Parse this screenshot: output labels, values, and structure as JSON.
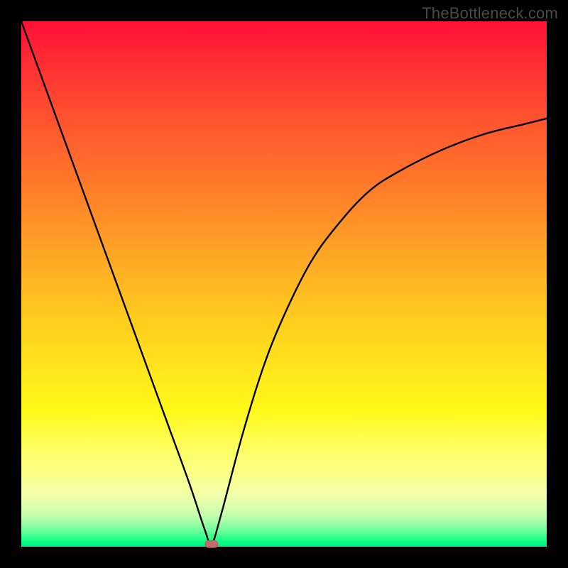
{
  "watermark": "TheBottleneck.com",
  "chart_data": {
    "type": "line",
    "title": "",
    "xlabel": "",
    "ylabel": "",
    "xlim": [
      0,
      100
    ],
    "ylim": [
      0,
      100
    ],
    "grid": false,
    "series": [
      {
        "name": "bottleneck-curve",
        "x": [
          0,
          4,
          8,
          12,
          16,
          20,
          24,
          28,
          32,
          35,
          36.2,
          38,
          42,
          46,
          50,
          55,
          60,
          66,
          72,
          80,
          88,
          96,
          100
        ],
        "values": [
          100,
          89,
          78,
          67,
          56,
          45,
          34,
          23,
          12,
          3,
          0.5,
          6,
          21,
          34,
          44,
          54,
          61,
          67.5,
          71.5,
          75.5,
          78.5,
          80.5,
          81.5
        ]
      }
    ],
    "annotations": [
      {
        "name": "minimum-marker",
        "x": 36.2,
        "y": 0.5,
        "shape": "pill",
        "color": "#c76a6a"
      }
    ],
    "background": {
      "type": "vertical-gradient",
      "stops": [
        {
          "pos": 0.0,
          "color": "#ff1037"
        },
        {
          "pos": 0.35,
          "color": "#ff8a28"
        },
        {
          "pos": 0.7,
          "color": "#ffe51c"
        },
        {
          "pos": 0.9,
          "color": "#f4ffa8"
        },
        {
          "pos": 1.0,
          "color": "#00f07f"
        }
      ]
    }
  }
}
